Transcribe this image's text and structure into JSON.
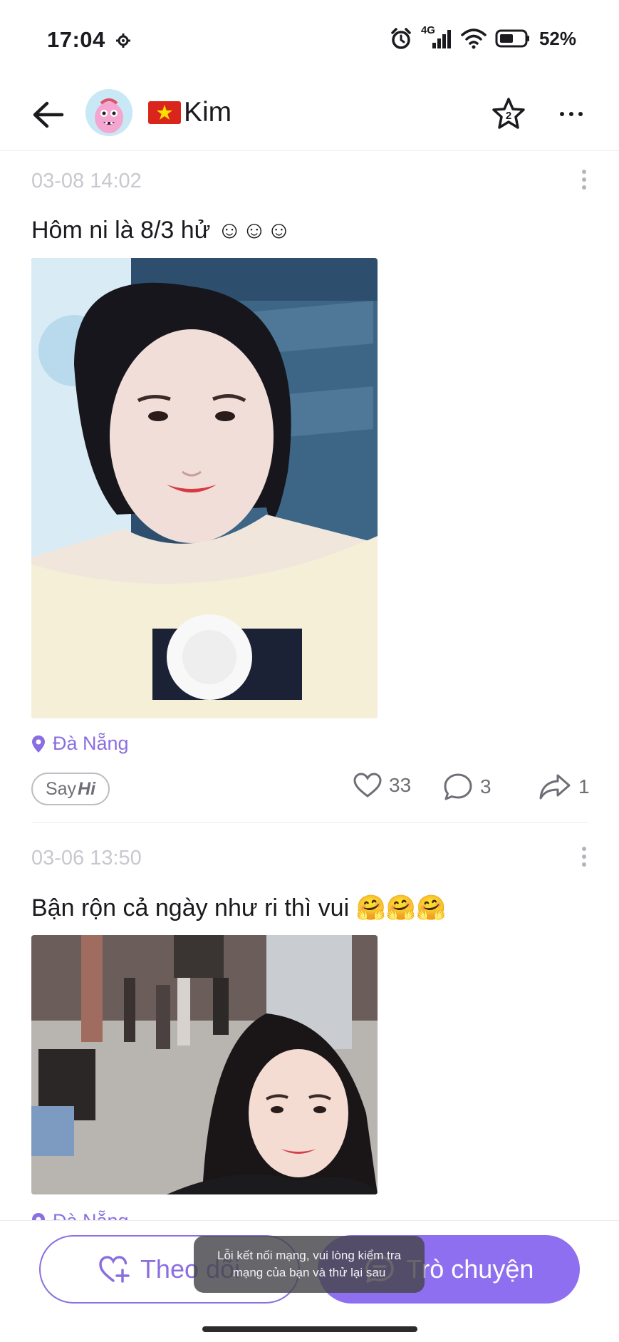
{
  "status_bar": {
    "time": "17:04",
    "network": "4G",
    "battery": "52%",
    "icons": [
      "settings-icon",
      "alarm-icon",
      "signal-icon",
      "wifi-icon",
      "battery-icon"
    ]
  },
  "header": {
    "name": "Kim",
    "flag": "vietnam-flag",
    "star_badge": "2"
  },
  "posts": [
    {
      "time": "03-08 14:02",
      "text": "Hôm ni là 8/3 hử ☺☺☺",
      "location": "Đà Nẵng",
      "sayhi": {
        "say": "Say",
        "hi": "Hi"
      },
      "likes": "33",
      "comments": "3",
      "shares": "1"
    },
    {
      "time": "03-06 13:50",
      "text": "Bận rộn cả ngày như ri thì vui 🤗🤗🤗",
      "location": "Đà Nẵng"
    }
  ],
  "bottom": {
    "follow_label": "Theo dõi",
    "chat_label": "Trò chuyện"
  },
  "toast": {
    "line1": "Lỗi kết nối mạng, vui lòng kiểm tra",
    "line2": "mạng của bạn và thử lại sau"
  },
  "colors": {
    "accent": "#8e6ff0",
    "location": "#8a6fe0",
    "muted": "#c8c8cf"
  }
}
